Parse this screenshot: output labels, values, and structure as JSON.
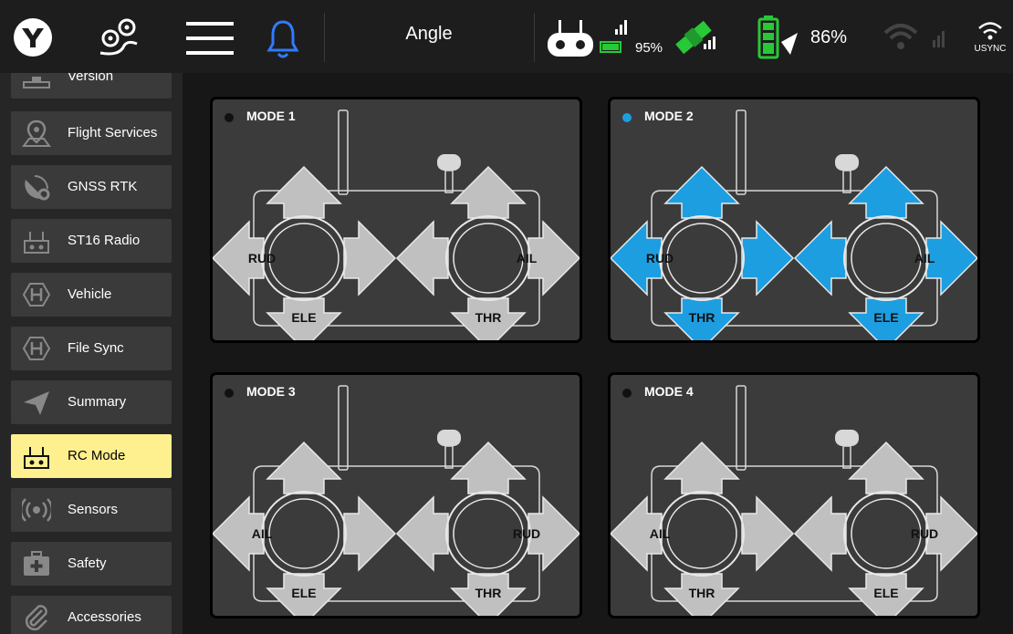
{
  "topbar": {
    "flight_mode": "Angle",
    "rc_signal_percent": "95%",
    "battery_percent": "86%",
    "wifi_label": "USYNC",
    "colors": {
      "bell": "#2f7bff",
      "gps": "#28c837",
      "battery": "#28c837"
    }
  },
  "sidebar": {
    "items": [
      {
        "label": "Version",
        "icon": "version-icon"
      },
      {
        "label": "Flight Services",
        "icon": "map-pin-icon"
      },
      {
        "label": "GNSS RTK",
        "icon": "satellite-gear-icon"
      },
      {
        "label": "ST16 Radio",
        "icon": "radio-icon"
      },
      {
        "label": "Vehicle",
        "icon": "hexagon-h-icon"
      },
      {
        "label": "File Sync",
        "icon": "hexagon-h-icon"
      },
      {
        "label": "Summary",
        "icon": "paper-plane-icon"
      },
      {
        "label": "RC Mode",
        "icon": "radio-icon",
        "active": true
      },
      {
        "label": "Sensors",
        "icon": "sensor-waves-icon"
      },
      {
        "label": "Safety",
        "icon": "first-aid-kit-icon"
      },
      {
        "label": "Accessories",
        "icon": "paperclip-icon"
      }
    ],
    "active_color": "#fff08f"
  },
  "modes": [
    {
      "title": "MODE 1",
      "selected": false,
      "left": {
        "l": "RUD",
        "b": "ELE"
      },
      "right": {
        "r": "AIL",
        "b": "THR"
      }
    },
    {
      "title": "MODE 2",
      "selected": true,
      "left": {
        "l": "RUD",
        "b": "THR"
      },
      "right": {
        "r": "AIL",
        "b": "ELE"
      }
    },
    {
      "title": "MODE 3",
      "selected": false,
      "left": {
        "l": "AIL",
        "b": "ELE"
      },
      "right": {
        "r": "RUD",
        "b": "THR"
      }
    },
    {
      "title": "MODE 4",
      "selected": false,
      "left": {
        "l": "AIL",
        "b": "THR"
      },
      "right": {
        "r": "RUD",
        "b": "ELE"
      }
    }
  ],
  "colors": {
    "selected": "#1d9ee1",
    "unselected": "#c0c0c0"
  }
}
